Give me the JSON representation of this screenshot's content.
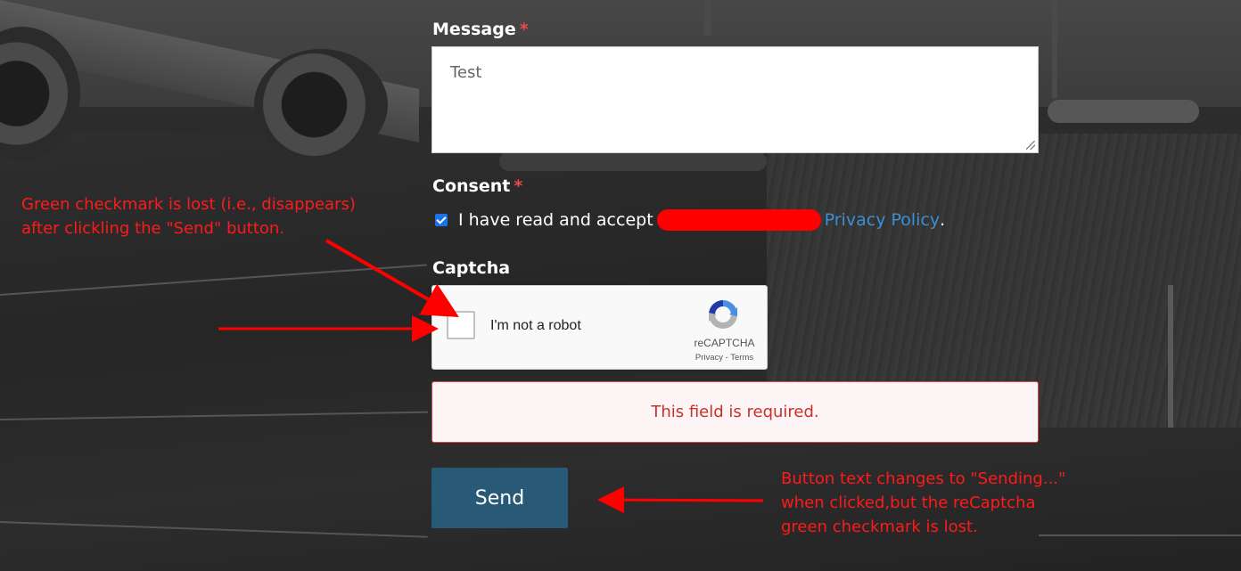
{
  "form": {
    "message": {
      "label": "Message",
      "required_mark": "*",
      "value": "Test"
    },
    "consent": {
      "label": "Consent",
      "required_mark": "*",
      "checked": true,
      "text_before": "I have read and accept",
      "link_text": "Privacy Policy",
      "text_after": "."
    },
    "captcha": {
      "label": "Captcha",
      "checkbox_text": "I'm not a robot",
      "brand": "reCAPTCHA",
      "links": "Privacy - Terms"
    },
    "error": {
      "text": "This field is required."
    },
    "send_button": {
      "label": "Send"
    }
  },
  "annotations": {
    "note_checkmark": "Green checkmark is lost (i.e., disappears)\nafter clickling the \"Send\" button.",
    "note_button": "Button text changes to \"Sending...\"\nwhen clicked,but the reCaptcha\ngreen checkmark is lost."
  },
  "colors": {
    "annotation": "#ff0000",
    "link": "#3b8fd6",
    "error": "#c9302c",
    "button": "#285a78"
  }
}
